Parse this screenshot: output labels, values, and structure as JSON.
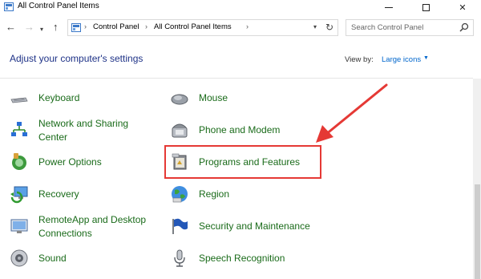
{
  "window": {
    "title": "All Control Panel Items"
  },
  "address_bar": {
    "crumbs": [
      "Control Panel",
      "All Control Panel Items"
    ]
  },
  "search": {
    "placeholder": "Search Control Panel"
  },
  "header": {
    "heading": "Adjust your computer's settings",
    "view_by_label": "View by:",
    "view_by_value": "Large icons"
  },
  "items": {
    "keyboard": "Keyboard",
    "mouse": "Mouse",
    "network_line1": "Network and Sharing",
    "network_line2": "Center",
    "phone_modem": "Phone and Modem",
    "power_options": "Power Options",
    "programs_features": "Programs and Features",
    "recovery": "Recovery",
    "region": "Region",
    "remoteapp_line1": "RemoteApp and Desktop",
    "remoteapp_line2": "Connections",
    "security_maintenance": "Security and Maintenance",
    "sound": "Sound",
    "speech_recognition": "Speech Recognition"
  },
  "colors": {
    "link_green": "#1a6b1a",
    "heading_blue": "#1e3287",
    "highlight_red": "#e53935",
    "arrow_red": "#e53935"
  }
}
